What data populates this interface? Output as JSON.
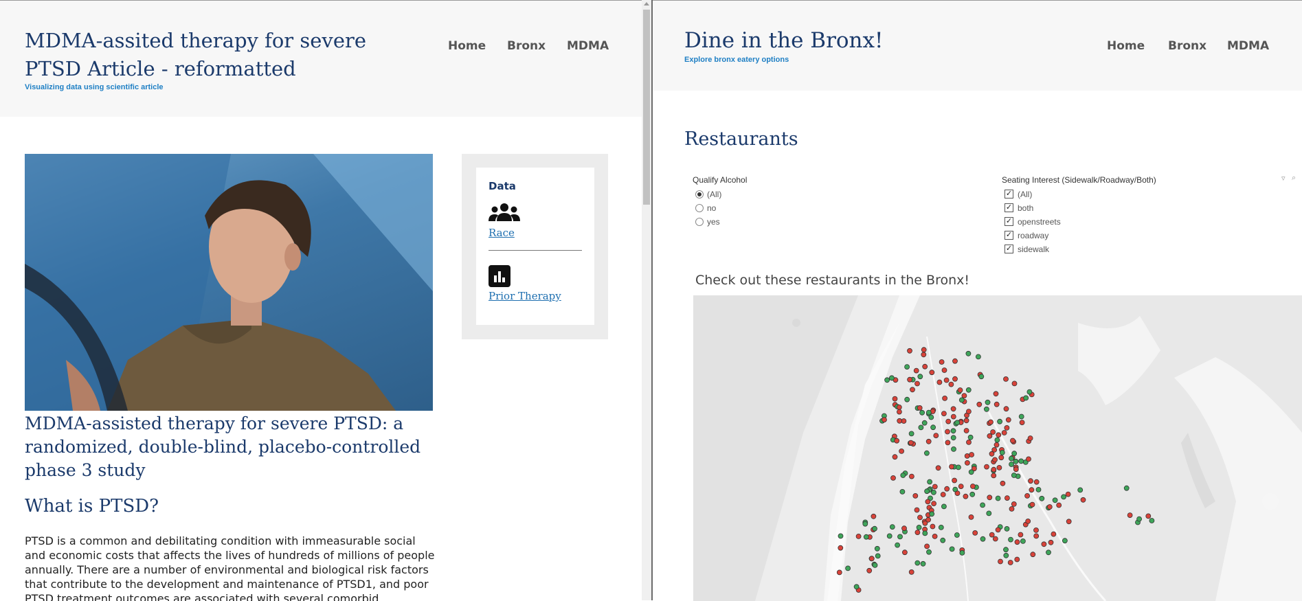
{
  "left": {
    "site_title": "MDMA-assited therapy for severe PTSD Article - reformatted",
    "tagline": "Visualizing data using scientific article",
    "nav": [
      "Home",
      "Bronx",
      "MDMA"
    ],
    "sidebar": {
      "title": "Data",
      "links": [
        {
          "label": "Race",
          "icon": "people-icon"
        },
        {
          "label": "Prior Therapy",
          "icon": "bar-chart-icon"
        }
      ]
    },
    "article_title": "MDMA-assisted therapy for severe PTSD: a randomized, double-blind, placebo-controlled phase 3 study",
    "section_heading": "What is PTSD?",
    "body_text": "PTSD is a common and debilitating condition with immeasurable social and economic costs that affects the lives of hundreds of millions of people annually. There are a number of environmental and biological risk factors that contribute to the development and maintenance of PTSD1, and poor PTSD treatment outcomes are associated with several comorbid"
  },
  "right": {
    "site_title": "Dine in the Bronx!",
    "tagline": "Explore bronx eatery options",
    "nav": [
      "Home",
      "Bronx",
      "MDMA"
    ],
    "section_heading": "Restaurants",
    "filters": {
      "alcohol": {
        "title": "Qualify Alcohol",
        "options": [
          "(All)",
          "no",
          "yes"
        ],
        "selected": "(All)"
      },
      "seating": {
        "title": "Seating Interest (Sidewalk/Roadway/Both)",
        "options": [
          "(All)",
          "both",
          "openstreets",
          "roadway",
          "sidewalk"
        ],
        "checked": [
          true,
          true,
          true,
          true,
          true
        ]
      }
    },
    "map_title": "Check out these restaurants in the Bronx!",
    "marker_colors": {
      "green": "#3fa55a",
      "red": "#d8433a"
    }
  }
}
